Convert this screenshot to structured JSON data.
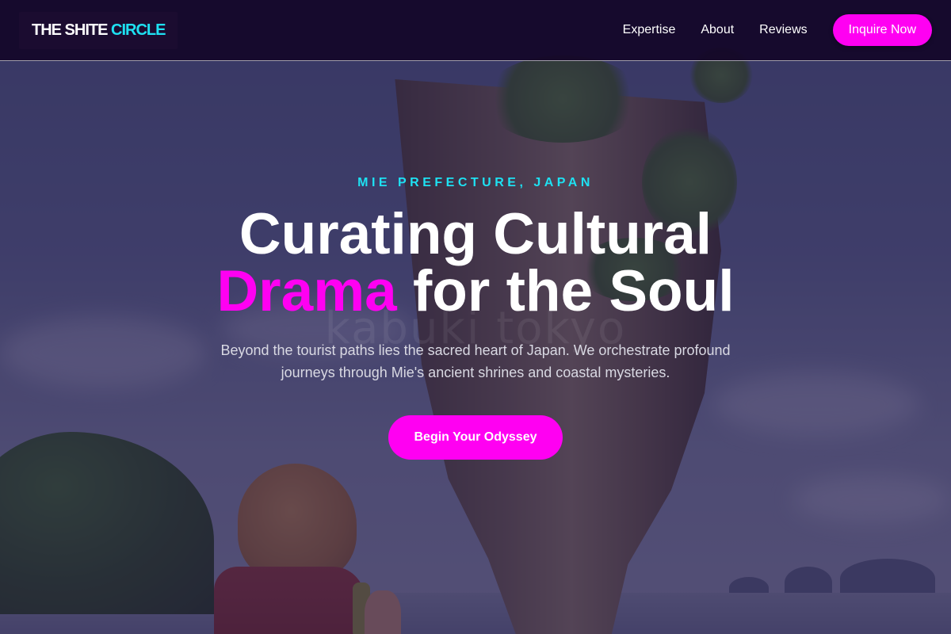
{
  "nav": {
    "logo_part1": "THE SHITE ",
    "logo_part2": "CIRCLE",
    "links": [
      "Expertise",
      "About",
      "Reviews"
    ],
    "cta_label": "Inquire Now"
  },
  "hero": {
    "eyebrow": "MIE PREFECTURE, JAPAN",
    "headline_line1": "Curating Cultural",
    "headline_highlight": "Drama",
    "headline_rest": " for the Soul",
    "watermark": "kabuki tokyo",
    "subtitle": "Beyond the tourist paths lies the sacred heart of Japan. We orchestrate profound journeys through Mie's ancient shrines and coastal mysteries.",
    "cta_label": "Begin Your Odyssey"
  },
  "colors": {
    "accent_magenta": "#ff00f2",
    "accent_cyan": "#1ee1f2",
    "nav_bg": "#14062a"
  }
}
